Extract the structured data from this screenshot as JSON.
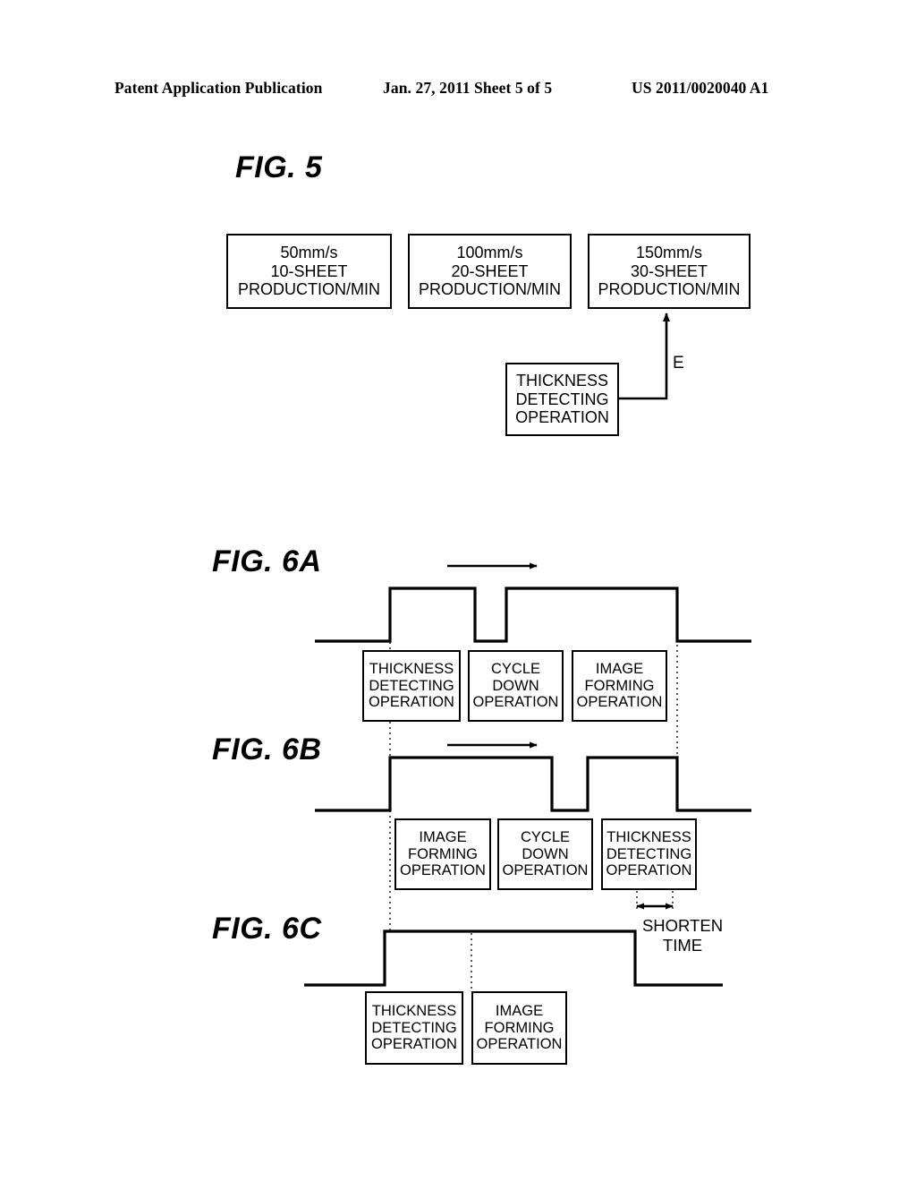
{
  "header": {
    "left": "Patent Application Publication",
    "middle": "Jan. 27, 2011  Sheet 5 of 5",
    "right": "US 2011/0020040 A1"
  },
  "figures": {
    "fig5": {
      "title": "FIG. 5",
      "speed_boxes": [
        {
          "line1": "50mm/s",
          "line2": "10-SHEET",
          "line3": "PRODUCTION/MIN"
        },
        {
          "line1": "100mm/s",
          "line2": "20-SHEET",
          "line3": "PRODUCTION/MIN"
        },
        {
          "line1": "150mm/s",
          "line2": "30-SHEET",
          "line3": "PRODUCTION/MIN"
        }
      ],
      "detect_box": {
        "line1": "THICKNESS",
        "line2": "DETECTING",
        "line3": "OPERATION"
      },
      "arrow_label": "E"
    },
    "fig6a": {
      "title": "FIG. 6A",
      "boxes": [
        {
          "line1": "THICKNESS",
          "line2": "DETECTING",
          "line3": "OPERATION"
        },
        {
          "line1": "CYCLE",
          "line2": "DOWN",
          "line3": "OPERATION"
        },
        {
          "line1": "IMAGE",
          "line2": "FORMING",
          "line3": "OPERATION"
        }
      ]
    },
    "fig6b": {
      "title": "FIG. 6B",
      "boxes": [
        {
          "line1": "IMAGE",
          "line2": "FORMING",
          "line3": "OPERATION"
        },
        {
          "line1": "CYCLE",
          "line2": "DOWN",
          "line3": "OPERATION"
        },
        {
          "line1": "THICKNESS",
          "line2": "DETECTING",
          "line3": "OPERATION"
        }
      ]
    },
    "fig6c": {
      "title": "FIG. 6C",
      "boxes": [
        {
          "line1": "THICKNESS",
          "line2": "DETECTING",
          "line3": "OPERATION"
        },
        {
          "line1": "IMAGE",
          "line2": "FORMING",
          "line3": "OPERATION"
        }
      ],
      "shorten_label_line1": "SHORTEN",
      "shorten_label_line2": "TIME"
    }
  }
}
